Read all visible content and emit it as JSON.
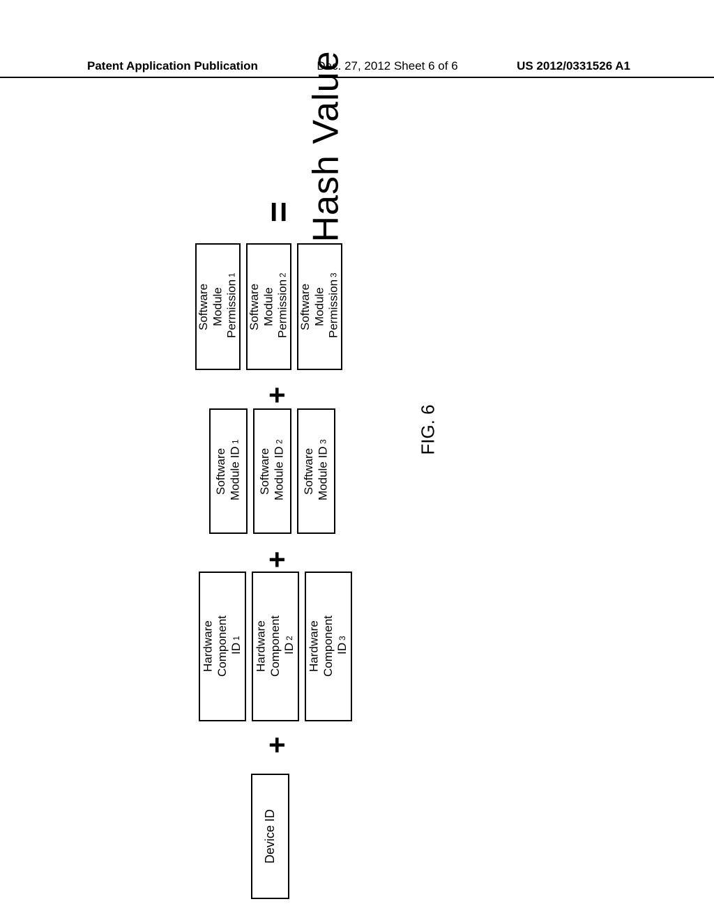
{
  "header": {
    "left": "Patent Application Publication",
    "center": "Dec. 27, 2012  Sheet 6 of 6",
    "right": "US 2012/0331526 A1"
  },
  "diagram": {
    "result": "Hash Value",
    "equals": "=",
    "plus": "+",
    "permissions": {
      "p1": {
        "line1": "Software",
        "line2": "Module",
        "line3": "Permission",
        "sub": "1"
      },
      "p2": {
        "line1": "Software",
        "line2": "Module",
        "line3": "Permission",
        "sub": "2"
      },
      "p3": {
        "line1": "Software",
        "line2": "Module",
        "line3": "Permission",
        "sub": "3"
      }
    },
    "modules": {
      "m1": {
        "line1": "Software",
        "line2": "Module ID",
        "sub": "1"
      },
      "m2": {
        "line1": "Software",
        "line2": "Module ID",
        "sub": "2"
      },
      "m3": {
        "line1": "Software",
        "line2": "Module ID",
        "sub": "3"
      }
    },
    "hardware": {
      "h1": {
        "line1": "Hardware",
        "line2": "Component",
        "line3": "ID",
        "sub": "1"
      },
      "h2": {
        "line1": "Hardware",
        "line2": "Component",
        "line3": "ID",
        "sub": "2"
      },
      "h3": {
        "line1": "Hardware",
        "line2": "Component",
        "line3": "ID",
        "sub": "3"
      }
    },
    "device": "Device ID"
  },
  "figure_label": "FIG. 6"
}
